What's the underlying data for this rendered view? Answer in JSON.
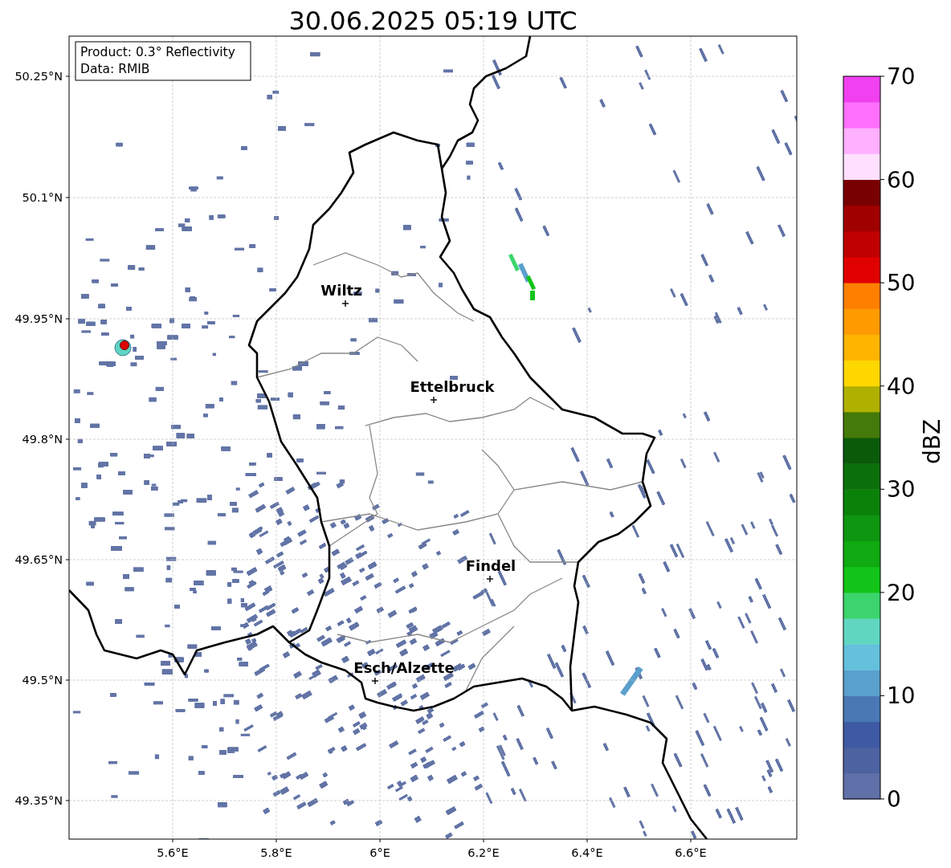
{
  "title": "30.06.2025 05:19 UTC",
  "info_box": [
    "Product: 0.3° Reflectivity",
    "Data: RMIB"
  ],
  "yticks": [
    "50.25°N",
    "50.1°N",
    "49.95°N",
    "49.8°N",
    "49.65°N",
    "49.5°N",
    "49.35°N"
  ],
  "xticks": [
    "5.6°E",
    "5.8°E",
    "6°E",
    "6.2°E",
    "6.4°E",
    "6.6°E"
  ],
  "places": [
    {
      "name": "Wiltz"
    },
    {
      "name": "Ettelbruck"
    },
    {
      "name": "Findel"
    },
    {
      "name": "Esch/Alzette"
    }
  ],
  "colorbar": {
    "label": "dBZ",
    "ticks": [
      "70",
      "60",
      "50",
      "40",
      "30",
      "20",
      "10",
      "0"
    ],
    "segments": [
      {
        "color": "#6070a8"
      },
      {
        "color": "#4d62a0"
      },
      {
        "color": "#3f5aa4"
      },
      {
        "color": "#4a78b4"
      },
      {
        "color": "#5aa0cc"
      },
      {
        "color": "#64c0dc"
      },
      {
        "color": "#60d6c0"
      },
      {
        "color": "#3cd46c"
      },
      {
        "color": "#12c418"
      },
      {
        "color": "#10aa12"
      },
      {
        "color": "#0e9610"
      },
      {
        "color": "#0a820a"
      },
      {
        "color": "#0b700b"
      },
      {
        "color": "#0a5a0a"
      },
      {
        "color": "#447a0a"
      },
      {
        "color": "#b0b000"
      },
      {
        "color": "#ffd700"
      },
      {
        "color": "#ffb400"
      },
      {
        "color": "#ff9b00"
      },
      {
        "color": "#ff7f00"
      },
      {
        "color": "#e00000"
      },
      {
        "color": "#c00000"
      },
      {
        "color": "#a00000"
      },
      {
        "color": "#780000"
      },
      {
        "color": "#ffe0ff"
      },
      {
        "color": "#ffb0ff"
      },
      {
        "color": "#ff70ff"
      },
      {
        "color": "#f040f0"
      }
    ]
  }
}
